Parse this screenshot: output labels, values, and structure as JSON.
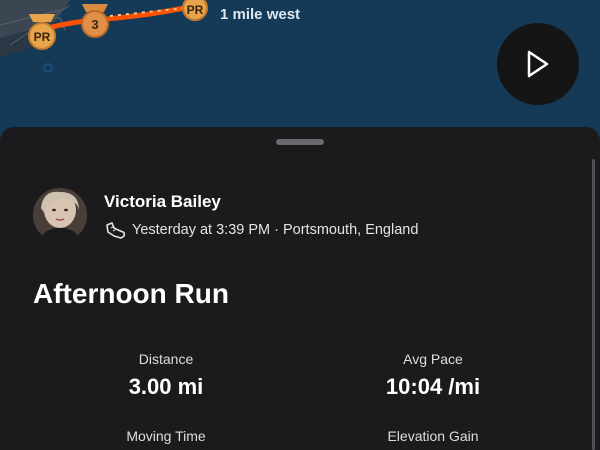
{
  "map": {
    "direction_text": "1 mile west",
    "badges": [
      {
        "label": "PR",
        "kind": "personal-record"
      },
      {
        "label": "3",
        "kind": "third-best"
      },
      {
        "label": "PR",
        "kind": "personal-record"
      }
    ],
    "colors": {
      "water": "#143a58",
      "route": "#fc5200",
      "badge": "#e8a44a"
    }
  },
  "play_button": {
    "icon": "play-icon"
  },
  "activity": {
    "athlete_name": "Victoria Bailey",
    "activity_icon": "shoe-icon",
    "meta": "Yesterday at 3:39 PM · Portsmouth, England",
    "title": "Afternoon Run"
  },
  "stats": {
    "distance_label": "Distance",
    "distance_value": "3.00 mi",
    "pace_label": "Avg Pace",
    "pace_value": "10:04 /mi",
    "moving_time_label": "Moving Time",
    "elevation_label": "Elevation Gain"
  }
}
